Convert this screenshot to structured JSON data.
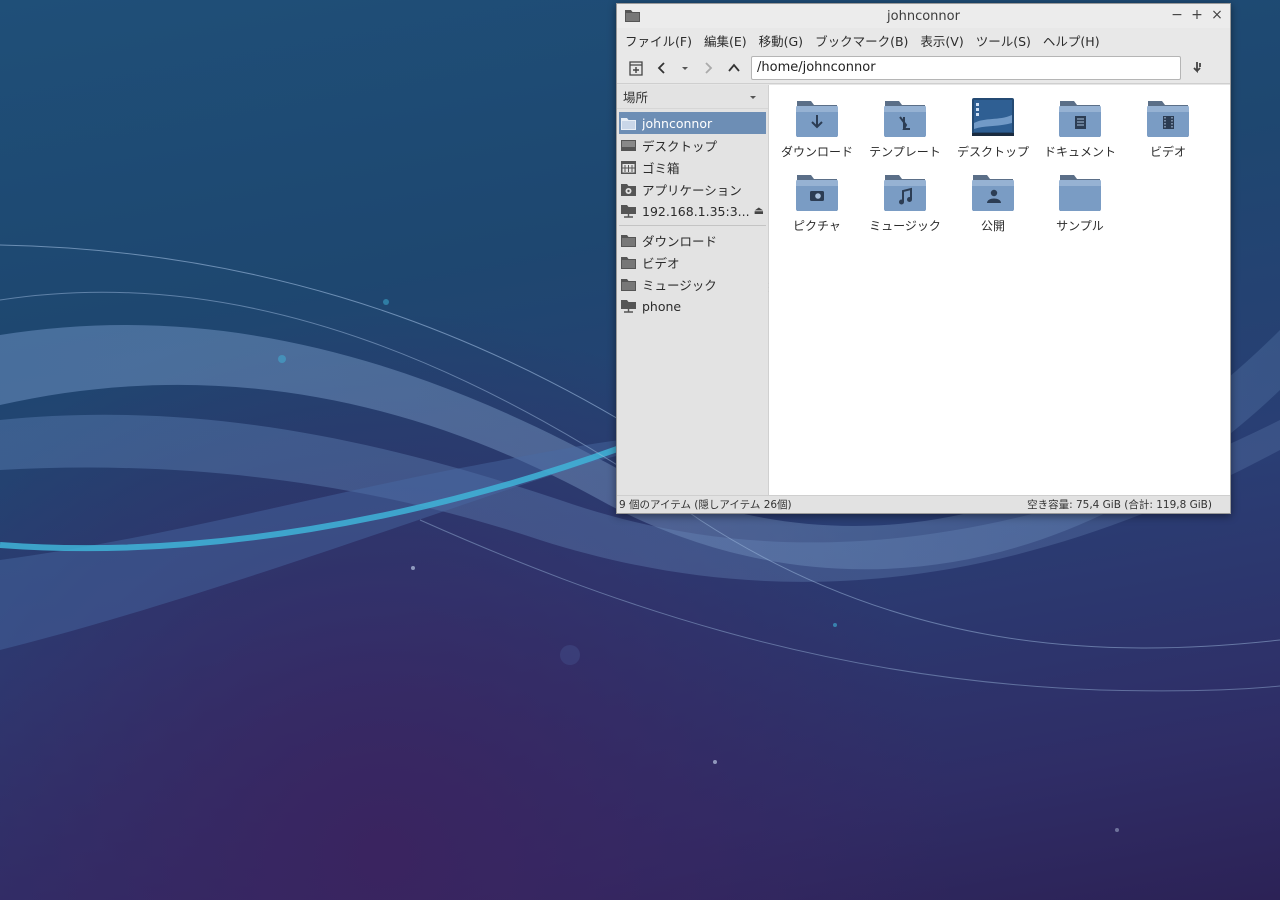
{
  "window": {
    "title": "johnconnor",
    "controls": {
      "minimize": "−",
      "maximize": "+",
      "close": "×"
    }
  },
  "menubar": [
    {
      "label": "ファイル(F)"
    },
    {
      "label": "編集(E)"
    },
    {
      "label": "移動(G)"
    },
    {
      "label": "ブックマーク(B)"
    },
    {
      "label": "表示(V)"
    },
    {
      "label": "ツール(S)"
    },
    {
      "label": "ヘルプ(H)"
    }
  ],
  "toolbar": {
    "location": "/home/johnconnor"
  },
  "sidebar": {
    "header": "場所",
    "places": [
      {
        "label": "johnconnor",
        "icon": "folder-icon"
      },
      {
        "label": "デスクトップ",
        "icon": "desktop-icon"
      },
      {
        "label": "ゴミ箱",
        "icon": "trash-icon"
      },
      {
        "label": "アプリケーション",
        "icon": "applications-icon"
      },
      {
        "label": "192.168.1.35:3...",
        "icon": "network-drive-icon"
      }
    ],
    "bookmarks": [
      {
        "label": "ダウンロード",
        "icon": "folder-icon"
      },
      {
        "label": "ビデオ",
        "icon": "folder-icon"
      },
      {
        "label": "ミュージック",
        "icon": "folder-icon"
      },
      {
        "label": "phone",
        "icon": "network-drive-icon"
      }
    ]
  },
  "files": [
    {
      "name": "ダウンロード",
      "icon": "download-folder-icon"
    },
    {
      "name": "テンプレート",
      "icon": "templates-folder-icon"
    },
    {
      "name": "デスクトップ",
      "icon": "desktop-folder-icon"
    },
    {
      "name": "ドキュメント",
      "icon": "documents-folder-icon"
    },
    {
      "name": "ビデオ",
      "icon": "videos-folder-icon"
    },
    {
      "name": "ピクチャ",
      "icon": "pictures-folder-icon"
    },
    {
      "name": "ミュージック",
      "icon": "music-folder-icon"
    },
    {
      "name": "公開",
      "icon": "public-folder-icon"
    },
    {
      "name": "サンプル",
      "icon": "folder-icon"
    }
  ],
  "statusbar": {
    "items": "9 個のアイテム (隠しアイテム 26個)",
    "space": "空き容量: 75,4 GiB (合計: 119,8 GiB)"
  },
  "colors": {
    "selection": "#6d8eb5",
    "folder": "#7a9cc4"
  }
}
